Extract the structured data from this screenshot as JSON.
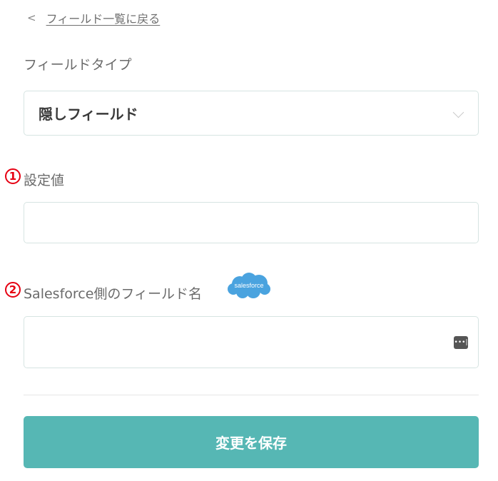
{
  "nav": {
    "back_chevron": "<",
    "back_label": "フィールド一覧に戻る"
  },
  "field_type": {
    "label": "フィールドタイプ",
    "selected": "隠しフィールド"
  },
  "setting_value": {
    "number": "1",
    "label": "設定値",
    "value": ""
  },
  "salesforce_field": {
    "number": "2",
    "label": "Salesforce側のフィールド名",
    "value": "",
    "logo_text": "salesforce"
  },
  "save": {
    "label": "変更を保存"
  },
  "colors": {
    "accent": "#56b7b4",
    "annotation": "#e60012",
    "salesforce_blue": "#4aa3df"
  }
}
